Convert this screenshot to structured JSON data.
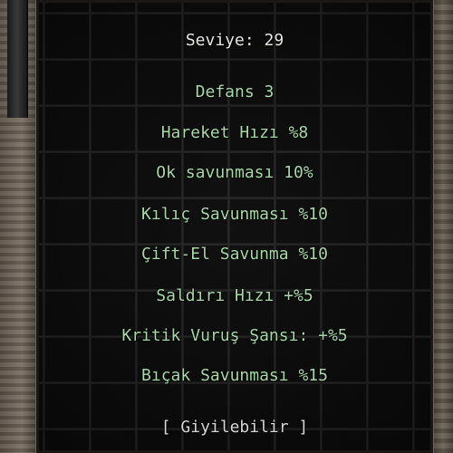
{
  "item_tooltip": {
    "level_text": "Seviye: 29",
    "bonuses": [
      "Defans 3",
      "Hareket Hızı %8",
      "Ok savunması 10%",
      "Kılıç Savunması %10",
      "Çift-El Savunma %10",
      "Saldırı Hızı +%5",
      "Kritik Vuruş Şansı: +%5",
      "Bıçak Savunması %15"
    ],
    "wearable_text": "[ Giyilebilir ]"
  },
  "colors": {
    "level_text": "#e8e8e0",
    "bonus_text": "#a8d8a8",
    "wearable_text": "#d8d8d8",
    "tooltip_bg": "#0c0c0c"
  }
}
